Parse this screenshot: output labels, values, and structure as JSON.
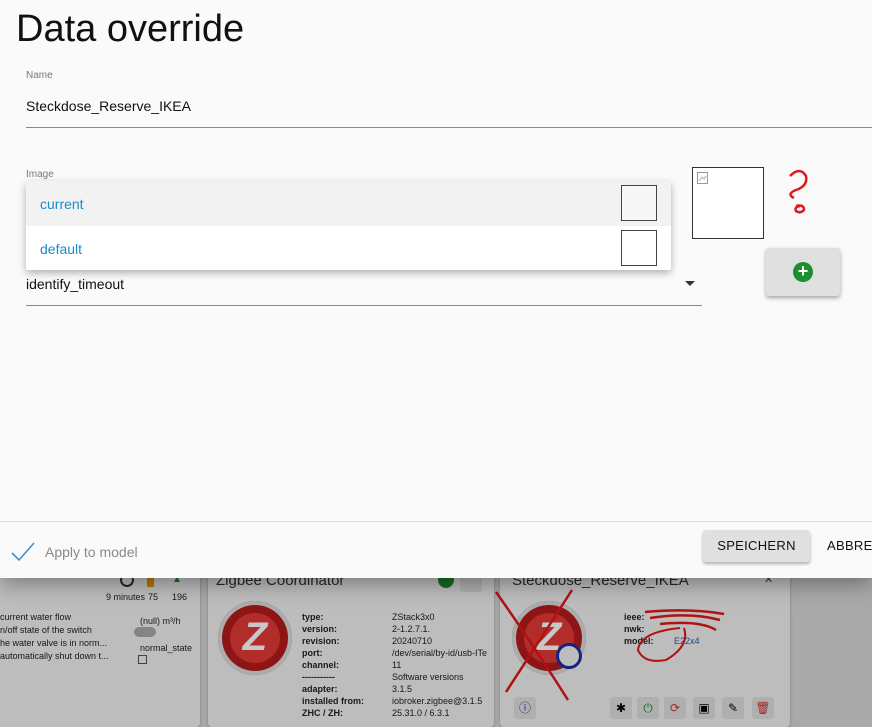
{
  "dialog": {
    "title": "Data override",
    "name_label": "Name",
    "name_value": "Steckdose_Reserve_IKEA",
    "image_label": "Image",
    "image_options": [
      {
        "label": "current",
        "selected": true
      },
      {
        "label": "default",
        "selected": false
      }
    ],
    "select_value": "identify_timeout",
    "apply_label": "Apply to model",
    "save_label": "SPEICHERN",
    "cancel_label": "ABBRECHEN"
  },
  "colors": {
    "accent_link": "#1a8cc4",
    "add_green": "#1b8e2e",
    "annotation_red": "#e01818"
  },
  "background": {
    "left_card": {
      "stats": [
        "9 minutes",
        "75",
        "196"
      ],
      "lines": [
        "current water flow",
        "n/off state of the switch",
        "he water valve is in norm...",
        "automatically shut down t..."
      ],
      "flow_value": "(null) m³/h",
      "state_label": "normal_state"
    },
    "coordinator": {
      "title": "Zigbee Coordinator",
      "rows": [
        {
          "k": "type:",
          "v": "ZStack3x0"
        },
        {
          "k": "version:",
          "v": "2-1.2.7.1."
        },
        {
          "k": "revision:",
          "v": "20240710"
        },
        {
          "k": "port:",
          "v": "/dev/serial/by-id/usb-ITe"
        },
        {
          "k": "channel:",
          "v": "11"
        },
        {
          "k": "-----------",
          "v": "Software versions"
        },
        {
          "k": "adapter:",
          "v": "3.1.5"
        },
        {
          "k": "installed from:",
          "v": "iobroker.zigbee@3.1.5"
        },
        {
          "k": "ZHC / ZH:",
          "v": "25.31.0 / 6.3.1"
        }
      ]
    },
    "device": {
      "title": "Steckdose_Reserve_IKEA",
      "rows": [
        {
          "k": "ieee:",
          "v": ""
        },
        {
          "k": "nwk:",
          "v": ""
        },
        {
          "k": "model:",
          "v": "E22x4"
        }
      ]
    }
  }
}
